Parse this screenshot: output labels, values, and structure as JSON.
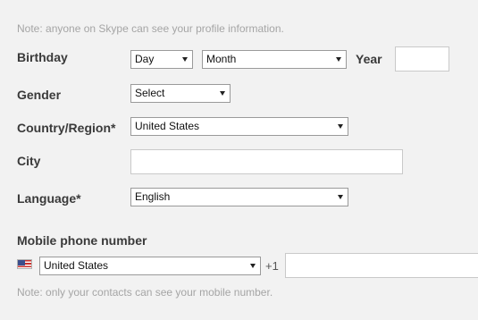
{
  "notes": {
    "profile": "Note: anyone on Skype can see your profile information.",
    "mobile": "Note: only your contacts can see your mobile number."
  },
  "birthday": {
    "label": "Birthday",
    "day": "Day",
    "month": "Month",
    "year_label": "Year",
    "year_value": ""
  },
  "gender": {
    "label": "Gender",
    "value": "Select"
  },
  "country": {
    "label": "Country/Region*",
    "value": "United States"
  },
  "city": {
    "label": "City",
    "value": ""
  },
  "language": {
    "label": "Language*",
    "value": "English"
  },
  "mobile": {
    "label": "Mobile phone number",
    "country": "United States",
    "code": "+1",
    "number": ""
  }
}
